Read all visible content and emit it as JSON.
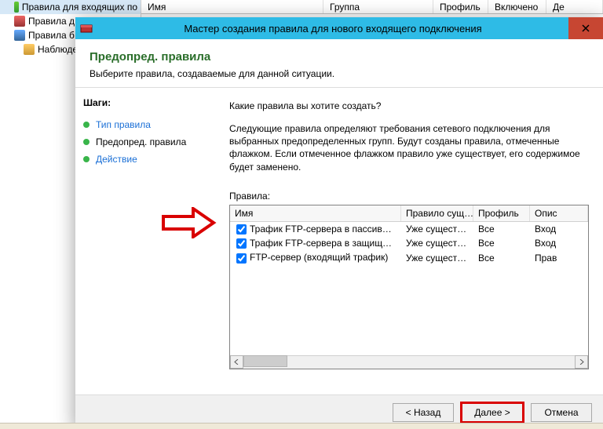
{
  "mmc": {
    "columns": [
      "Имя",
      "Группа",
      "Профиль",
      "Включено",
      "Де"
    ],
    "tree": [
      {
        "label": "Правила для входящих по",
        "icon": "ic-green",
        "selected": true
      },
      {
        "label": "Правила д",
        "icon": "ic-red"
      },
      {
        "label": "Правила б",
        "icon": "ic-blue"
      },
      {
        "label": "Наблюден",
        "icon": "ic-yellow"
      }
    ]
  },
  "dialog": {
    "title": "Мастер создания правила для нового входящего подключения",
    "close_glyph": "✕",
    "header": {
      "title": "Предопред. правила",
      "subtitle": "Выберите правила, создаваемые для данной ситуации."
    },
    "steps_label": "Шаги:",
    "steps": [
      {
        "label": "Тип правила",
        "active": false
      },
      {
        "label": "Предопред. правила",
        "active": true
      },
      {
        "label": "Действие",
        "active": false
      }
    ],
    "content": {
      "prompt": "Какие правила вы хотите создать?",
      "explain": "Следующие правила определяют требования сетевого подключения для выбранных предопределенных групп. Будут созданы правила, отмеченные флажком. Если отмеченное флажком правило уже существует, его содержимое будет заменено.",
      "rules_label": "Правила:",
      "columns": {
        "name": "Имя",
        "exists": "Правило сущ…",
        "profile": "Профиль",
        "desc": "Опис"
      },
      "rows": [
        {
          "checked": true,
          "name": "Трафик FTP-сервера в пассивном режим…",
          "exists": "Уже существ…",
          "profile": "Все",
          "desc": "Вход"
        },
        {
          "checked": true,
          "name": "Трафик FTP-сервера в защищенном режи…",
          "exists": "Уже существ…",
          "profile": "Все",
          "desc": "Вход"
        },
        {
          "checked": true,
          "name": "FTP-сервер (входящий трафик)",
          "exists": "Уже существ…",
          "profile": "Все",
          "desc": "Прав"
        }
      ]
    },
    "buttons": {
      "back": "< Назад",
      "next": "Далее >",
      "cancel": "Отмена"
    }
  }
}
